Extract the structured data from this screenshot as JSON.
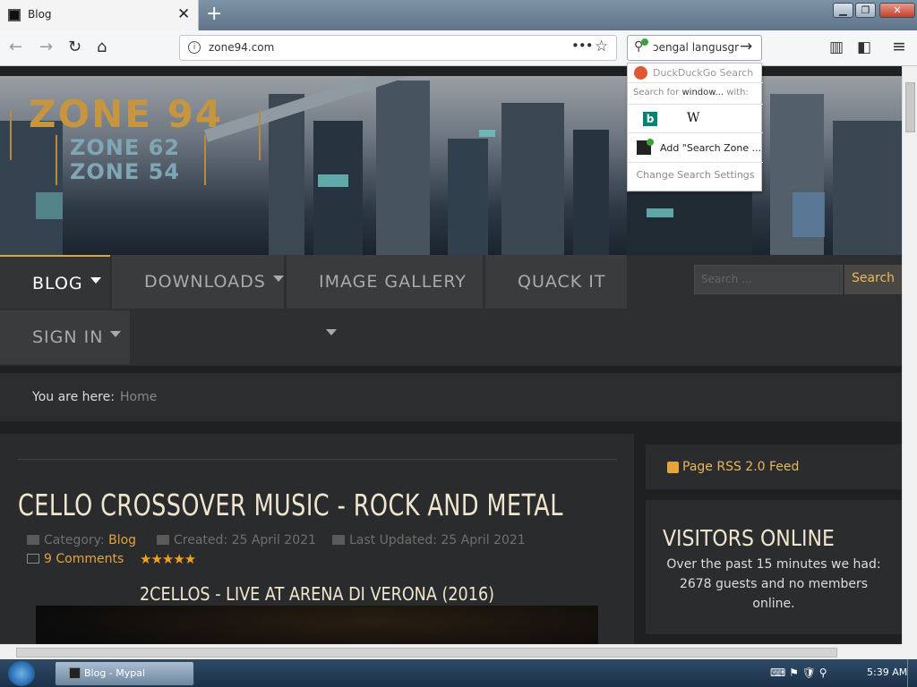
{
  "browser": {
    "tab_title": "Blog",
    "url": "zone94.com",
    "search_query": "ɔengal langusgr"
  },
  "search_dropdown": {
    "engine_label": "DuckDuckGo Search",
    "search_for_prefix": "Search for",
    "search_for_term": "window...",
    "search_for_suffix": "with:",
    "wiki_glyph": "W",
    "bing_glyph": "b",
    "add_engine": "Add \"Search Zone ...",
    "change_settings": "Change Search Settings"
  },
  "site": {
    "logo_main": "ZONE 94",
    "logo_sub1": "ZONE 62",
    "logo_sub2": "ZONE 54",
    "menu": {
      "blog": "BLOG",
      "downloads": "DOWNLOADS",
      "gallery": "IMAGE GALLERY",
      "quack": "QUACK IT",
      "signin": "SIGN IN"
    },
    "search_placeholder": "Search ...",
    "search_button": "Search",
    "breadcrumb_label": "You are here:",
    "breadcrumb_home": "Home"
  },
  "article": {
    "title": "CELLO CROSSOVER MUSIC - ROCK AND METAL",
    "category_label": "Category:",
    "category": "Blog",
    "created": "Created: 25 April 2021",
    "updated": "Last Updated: 25 April 2021",
    "comments": "9 Comments",
    "rating": "★★★★★",
    "subtitle": "2CELLOS - LIVE AT ARENA DI VERONA (2016)"
  },
  "sidebar": {
    "rss": "Page RSS 2.0 Feed",
    "visitors_heading": "VISITORS ONLINE",
    "visitors_text": "Over the past 15 minutes we had: 2678 guests and no members online."
  },
  "taskbar": {
    "window": "Blog - Mypal",
    "time": "5:39 AM"
  },
  "colors": {
    "accent": "#e3a53f",
    "heading": "#f0e6cf",
    "page_bg": "#1f2021"
  }
}
